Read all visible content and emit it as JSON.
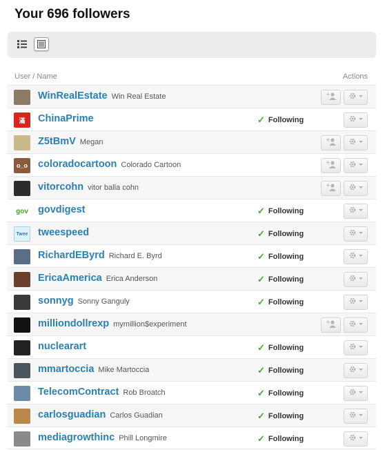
{
  "page": {
    "title": "Your 696 followers"
  },
  "columns": {
    "user": "User / Name",
    "actions": "Actions"
  },
  "colors": {
    "link": "#2a7fb3",
    "check": "#4aa52a",
    "alt_row": "#f6f6f6"
  },
  "users": [
    {
      "screen": "WinRealEstate",
      "name": "Win Real Estate",
      "following": false,
      "status": "",
      "avatar_color": "#8c7a64",
      "avatar_text": ""
    },
    {
      "screen": "ChinaPrime",
      "name": "",
      "following": true,
      "status": "Following",
      "avatar_color": "#d9261c",
      "avatar_text": "滿"
    },
    {
      "screen": "Z5tBmV",
      "name": "Megan",
      "following": false,
      "status": "",
      "avatar_color": "#c9b98a",
      "avatar_text": ""
    },
    {
      "screen": "coloradocartoon",
      "name": "Colorado Cartoon",
      "following": false,
      "status": "",
      "avatar_color": "#8a5a3a",
      "avatar_text": "o_o"
    },
    {
      "screen": "vitorcohn",
      "name": "vitor balla cohn",
      "following": false,
      "status": "",
      "avatar_color": "#2b2b2b",
      "avatar_text": ""
    },
    {
      "screen": "govdigest",
      "name": "",
      "following": true,
      "status": "Following",
      "avatar_color": "#ffffff",
      "avatar_text": "gov"
    },
    {
      "screen": "tweespeed",
      "name": "",
      "following": true,
      "status": "Following",
      "avatar_color": "#dff2fb",
      "avatar_text": "Twee"
    },
    {
      "screen": "RichardEByrd",
      "name": "Richard E. Byrd",
      "following": true,
      "status": "Following",
      "avatar_color": "#5a6e86",
      "avatar_text": ""
    },
    {
      "screen": "EricaAmerica",
      "name": "Erica Anderson",
      "following": true,
      "status": "Following",
      "avatar_color": "#6b3e2e",
      "avatar_text": ""
    },
    {
      "screen": "sonnyg",
      "name": "Sonny Ganguly",
      "following": true,
      "status": "Following",
      "avatar_color": "#3a3a3a",
      "avatar_text": ""
    },
    {
      "screen": "milliondollrexp",
      "name": "mymillion$experiment",
      "following": false,
      "status": "",
      "avatar_color": "#111111",
      "avatar_text": ""
    },
    {
      "screen": "nuclearart",
      "name": "",
      "following": true,
      "status": "Following",
      "avatar_color": "#222222",
      "avatar_text": ""
    },
    {
      "screen": "mmartoccia",
      "name": "Mike Martoccia",
      "following": true,
      "status": "Following",
      "avatar_color": "#4a5560",
      "avatar_text": ""
    },
    {
      "screen": "TelecomContract",
      "name": "Rob Broatch",
      "following": true,
      "status": "Following",
      "avatar_color": "#6a8aa8",
      "avatar_text": ""
    },
    {
      "screen": "carlosguadian",
      "name": "Carlos Guadian",
      "following": true,
      "status": "Following",
      "avatar_color": "#b8884a",
      "avatar_text": ""
    },
    {
      "screen": "mediagrowthinc",
      "name": "Phill Longmire",
      "following": true,
      "status": "Following",
      "avatar_color": "#8a8a8a",
      "avatar_text": ""
    }
  ]
}
